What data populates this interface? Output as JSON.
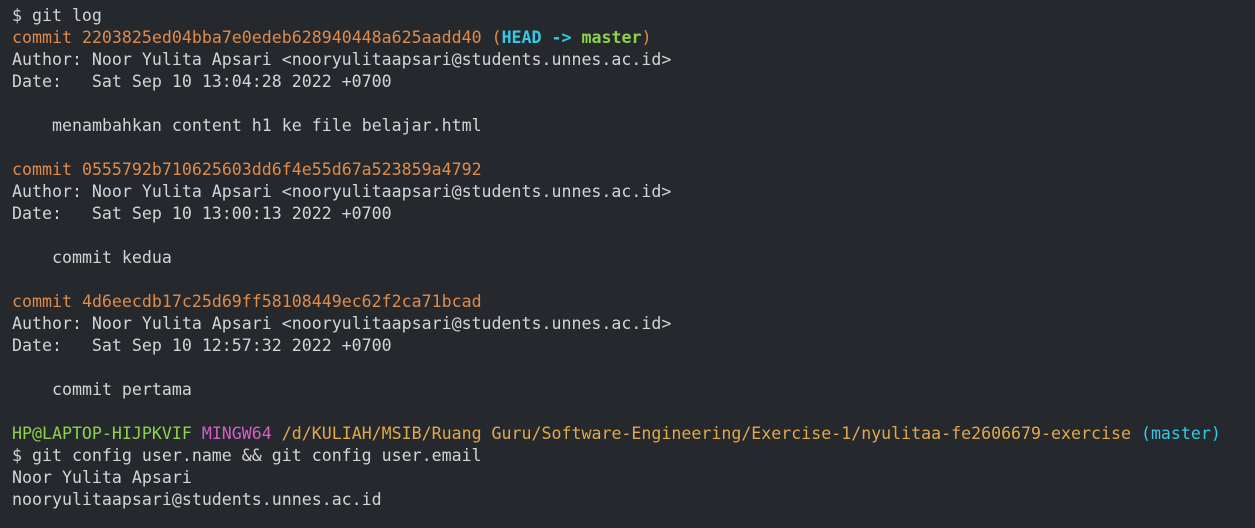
{
  "terminal": {
    "commands": {
      "git_log": "$ git log",
      "config": "$ git config user.name && git config user.email"
    },
    "commits": [
      {
        "label": "commit",
        "hash": "2203825ed04bba7e0edeb628940448a625aadd40",
        "refs": {
          "head": "HEAD",
          "arrow": "->",
          "branch": "master"
        },
        "author_line": "Author: Noor Yulita Apsari <nooryulitaapsari@students.unnes.ac.id>",
        "date_line": "Date:   Sat Sep 10 13:04:28 2022 +0700",
        "message": "menambahkan content h1 ke file belajar.html"
      },
      {
        "label": "commit",
        "hash": "0555792b710625603dd6f4e55d67a523859a4792",
        "author_line": "Author: Noor Yulita Apsari <nooryulitaapsari@students.unnes.ac.id>",
        "date_line": "Date:   Sat Sep 10 13:00:13 2022 +0700",
        "message": "commit kedua"
      },
      {
        "label": "commit",
        "hash": "4d6eecdb17c25d69ff58108449ec62f2ca71bcad",
        "author_line": "Author: Noor Yulita Apsari <nooryulitaapsari@students.unnes.ac.id>",
        "date_line": "Date:   Sat Sep 10 12:57:32 2022 +0700",
        "message": "commit pertama"
      }
    ],
    "prompt": {
      "user_host": "HP@LAPTOP-HIJPKVIF",
      "env": "MINGW64",
      "path": "/d/KULIAH/MSIB/Ruang Guru/Software-Engineering/Exercise-1/nyulitaa-fe2606679-exercise",
      "branch": "(master)"
    },
    "output": {
      "user_name": "Noor Yulita Apsari",
      "user_email": "nooryulitaapsari@students.unnes.ac.id"
    }
  },
  "colors": {
    "background": "#25282d",
    "text": "#d4d4d4",
    "commit": "#e08b4a",
    "head": "#36c9e6",
    "branch": "#8fd14b",
    "mingw": "#d65ec7",
    "path": "#e0a94a"
  }
}
